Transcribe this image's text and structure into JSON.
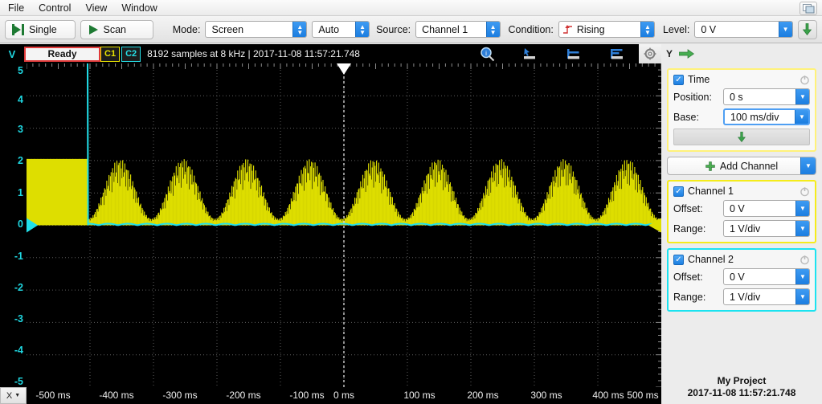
{
  "menubar": {
    "items": [
      {
        "label": "File"
      },
      {
        "label": "Control"
      },
      {
        "label": "View"
      },
      {
        "label": "Window"
      }
    ],
    "window_button_icon": "window-panels-icon"
  },
  "toolbar": {
    "single_label": "Single",
    "single_icon": "single-capture-icon",
    "scan_label": "Scan",
    "scan_icon": "play-icon",
    "mode_label": "Mode:",
    "mode_value": "Screen",
    "sweep_value": "Auto",
    "source_label": "Source:",
    "source_value": "Channel 1",
    "condition_label": "Condition:",
    "condition_value": "Rising",
    "condition_icon": "rising-edge-icon",
    "level_label": "Level:",
    "level_value": "0 V",
    "trigger_down_icon": "green-down-arrow-icon"
  },
  "statusbar": {
    "y_axis_button": "V",
    "state": "Ready",
    "channel_chips": [
      {
        "label": "C1",
        "color": "#e8e400"
      },
      {
        "label": "C2",
        "color": "#26e0e8"
      }
    ],
    "sample_info": "8192 samples at 8 kHz | 2017-11-08 11:57:21.748",
    "icons": [
      "zoom-magnifier-icon",
      "cursor-top-left-icon",
      "cursor-center-icon",
      "cursor-bottom-left-icon"
    ],
    "gear_icon": "gear-icon",
    "y_toggle_label": "Y",
    "x_arrow_icon": "green-right-arrow-icon"
  },
  "plot": {
    "x_axis_button_label": "X",
    "x_axis_button_icon": "chevron-down-icon",
    "trigger_marker_icon": "trigger-down-triangle-icon",
    "left_marker_icon": "channel2-level-triangle-icon",
    "right_marker_icon": "channel1-level-triangle-icon"
  },
  "panel": {
    "time": {
      "title": "Time",
      "enabled": true,
      "power_icon": "power-icon",
      "position_label": "Position:",
      "position_value": "0 s",
      "base_label": "Base:",
      "base_value": "100 ms/div",
      "down_arrow_icon": "green-down-arrow-icon"
    },
    "add_channel": {
      "label": "Add Channel",
      "plus_icon": "green-plus-icon"
    },
    "channels": [
      {
        "title": "Channel 1",
        "enabled": true,
        "power_icon": "power-icon",
        "offset_label": "Offset:",
        "offset_value": "0 V",
        "range_label": "Range:",
        "range_value": "1 V/div",
        "color": "#f5ec1b"
      },
      {
        "title": "Channel 2",
        "enabled": true,
        "power_icon": "power-icon",
        "offset_label": "Offset:",
        "offset_value": "0 V",
        "range_label": "Range:",
        "range_value": "1 V/div",
        "color": "#1ce3f0"
      }
    ],
    "project": {
      "name": "My Project",
      "timestamp": "2017-11-08 11:57:21.748"
    }
  },
  "chart_data": {
    "type": "line",
    "title": "Oscilloscope capture",
    "xlabel": "Time",
    "ylabel": "V",
    "xlim": [
      -500,
      500
    ],
    "ylim": [
      -5,
      5
    ],
    "x_unit": "ms",
    "y_unit": "V",
    "x_ticks": [
      -500,
      -400,
      -300,
      -200,
      -100,
      0,
      100,
      200,
      300,
      400,
      500
    ],
    "x_tick_labels": [
      "-500 ms",
      "-400 ms",
      "-300 ms",
      "-200 ms",
      "-100 ms",
      "0 ms",
      "100 ms",
      "200 ms",
      "300 ms",
      "400 ms",
      "500 ms"
    ],
    "y_ticks": [
      5,
      4,
      3,
      2,
      1,
      0,
      -1,
      -2,
      -3,
      -4,
      -5
    ],
    "y_tick_labels": [
      "5",
      "4",
      "3",
      "2",
      "1",
      "0",
      "-1",
      "-2",
      "-3",
      "-4",
      "-5"
    ],
    "grid": true,
    "background": "#000000",
    "trigger_time_ms": 0,
    "series": [
      {
        "name": "Channel 1",
        "color": "#dede00",
        "description": "Dense carrier burst filling 0 V to ~2.05 V. Flat-topped (saturated) from -500 ms to -403 ms, then amplitude-modulated with a sinusoidal envelope of period ~100 ms for the remainder of the sweep.",
        "baseline_v": 0,
        "peak_v": 2.05,
        "carrier_hz": 160,
        "envelope_period_ms": 100,
        "saturated_until_ms": -403
      },
      {
        "name": "Channel 2",
        "color": "#22e0ea",
        "description": "Digital gate: high at ~5.1 V from -500 ms until -403 ms, falling edge at -403 ms, then low at ~0 V (with small noise) until 500 ms.",
        "high_v": 5.1,
        "low_v": 0,
        "falling_edge_ms": -403
      }
    ]
  }
}
